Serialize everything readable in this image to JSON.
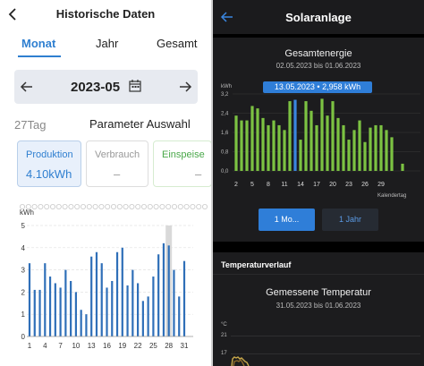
{
  "left": {
    "header": {
      "title": "Historische Daten",
      "back_icon": "chevron-left-icon"
    },
    "tabs": [
      {
        "label": "Monat",
        "active": true
      },
      {
        "label": "Jahr",
        "active": false
      },
      {
        "label": "Gesamt",
        "active": false
      }
    ],
    "period": {
      "value": "2023-05",
      "prev_icon": "arrow-left-icon",
      "next_icon": "arrow-right-icon",
      "calendar_icon": "calendar-icon"
    },
    "day_count": "27Tag",
    "param_label": "Parameter Auswahl",
    "cards": [
      {
        "label": "Produktion",
        "value": "4.10kWh",
        "active": true
      },
      {
        "label": "Verbrauch",
        "value": "–",
        "active": false
      },
      {
        "label": "Einspeise",
        "value": "–",
        "active": false
      }
    ],
    "accent": "#2f7fd0",
    "chart_data": {
      "type": "bar",
      "ylabel": "kWh",
      "ylim": [
        0,
        5
      ],
      "yticks": [
        0,
        1,
        2,
        3,
        4,
        5
      ],
      "xticks": [
        1,
        4,
        7,
        10,
        13,
        16,
        19,
        22,
        25,
        28,
        31
      ],
      "highlight_day": 28,
      "x": [
        1,
        2,
        3,
        4,
        5,
        6,
        7,
        8,
        9,
        10,
        11,
        12,
        13,
        14,
        15,
        16,
        17,
        18,
        19,
        20,
        21,
        22,
        23,
        24,
        25,
        26,
        27,
        28,
        29,
        30,
        31
      ],
      "values": [
        3.3,
        2.1,
        2.1,
        3.3,
        2.7,
        2.4,
        2.2,
        3.0,
        2.5,
        2.0,
        1.2,
        1.0,
        3.6,
        3.8,
        3.3,
        2.2,
        2.5,
        3.8,
        4.0,
        2.3,
        3.0,
        2.4,
        1.6,
        1.8,
        2.7,
        3.7,
        4.2,
        4.1,
        3.0,
        1.8,
        3.4
      ],
      "bar_color": "#2f6fb8"
    }
  },
  "right": {
    "header": {
      "title": "Solaranlage",
      "back_icon": "arrow-left-icon"
    },
    "energy": {
      "title": "Gesamtenergie",
      "subtitle": "02.05.2023 bis 01.06.2023",
      "tooltip": "13.05.2023 • 2,958 kWh"
    },
    "chart_data": {
      "type": "bar",
      "ylabel": "kWh",
      "xlabel": "Kalendertag",
      "ylim": [
        0,
        3.2
      ],
      "yticks": [
        "0,0",
        "0,8",
        "1,6",
        "2,4",
        "3,2"
      ],
      "xticks": [
        2,
        5,
        8,
        11,
        14,
        17,
        20,
        23,
        26,
        29
      ],
      "highlight_day": 13,
      "x": [
        2,
        3,
        4,
        5,
        6,
        7,
        8,
        9,
        10,
        11,
        12,
        13,
        14,
        15,
        16,
        17,
        18,
        19,
        20,
        21,
        22,
        23,
        24,
        25,
        26,
        27,
        28,
        29,
        30,
        31,
        32,
        33
      ],
      "values": [
        2.3,
        2.1,
        2.1,
        2.7,
        2.6,
        2.2,
        1.9,
        2.1,
        1.9,
        1.7,
        2.9,
        2.958,
        1.3,
        2.9,
        2.5,
        1.9,
        3.0,
        2.3,
        2.9,
        2.2,
        1.9,
        1.3,
        1.7,
        2.1,
        1.2,
        1.8,
        1.9,
        1.9,
        1.7,
        1.4,
        0,
        0.3
      ],
      "bar_color": "#7cc242",
      "highlight_color": "#3a86e0"
    },
    "buttons": {
      "month_label": "1 Mo...",
      "year_label": "1 Jahr"
    },
    "temp_section": {
      "title": "Temperaturverlauf",
      "chart_title": "Gemessene Temperatur",
      "subtitle": "31.05.2023 bis 01.06.2023",
      "ylabel": "°C",
      "yticks": [
        21,
        17
      ]
    }
  }
}
